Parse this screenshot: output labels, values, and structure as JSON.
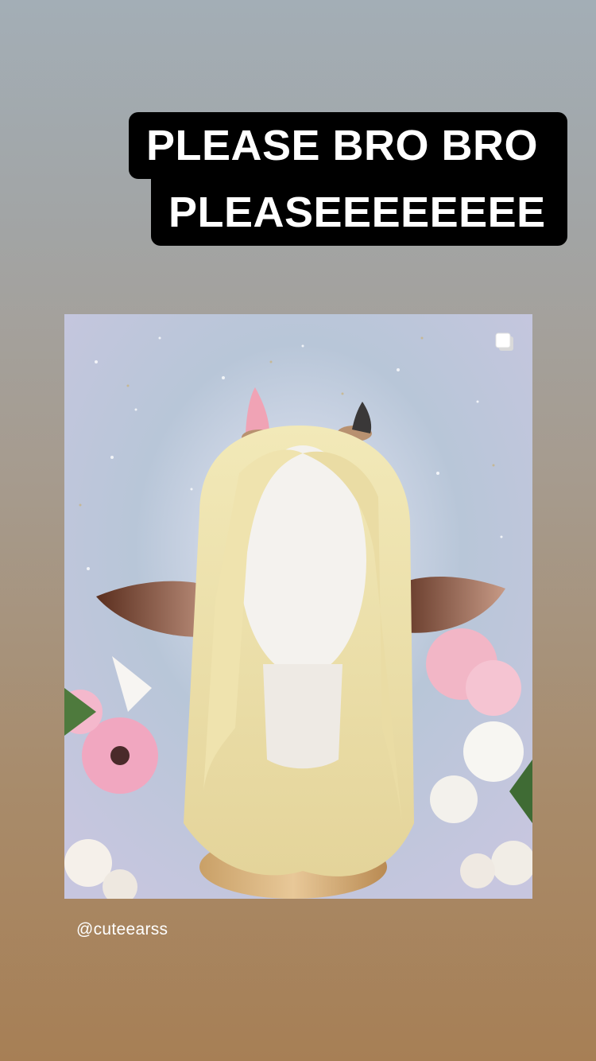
{
  "story": {
    "caption_lines": [
      "PLEASE BRO BRO",
      "PLEASEEEEEEEE"
    ],
    "handle": "@cuteearss"
  },
  "post": {
    "icons": [
      "multiple-photos-icon"
    ]
  },
  "colors": {
    "caption_bg": "#000000",
    "caption_text": "#ffffff",
    "background_top": "#a3aeb6",
    "background_bottom": "#a77f55"
  }
}
